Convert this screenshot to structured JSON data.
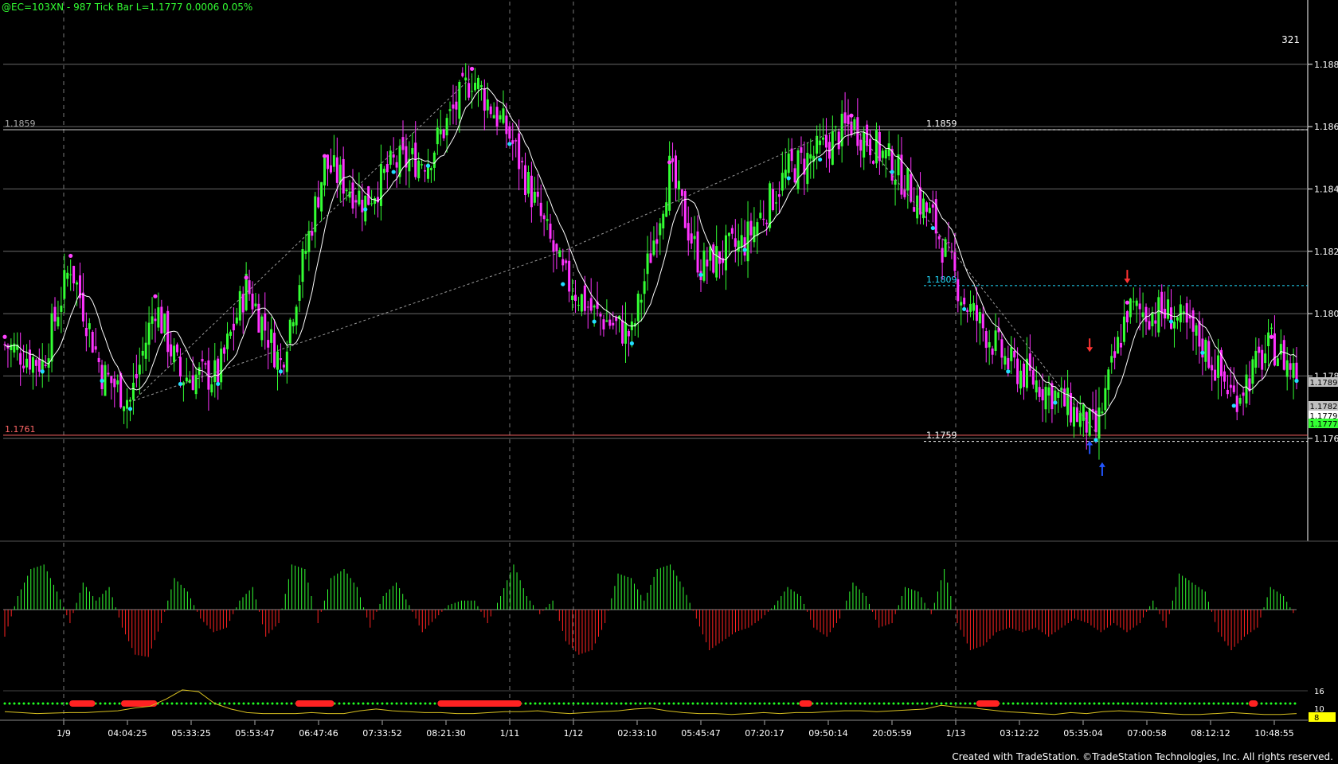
{
  "window": {
    "header": "@EC=103XN - 987 Tick Bar  L=1.1777  0.0006  0.05%",
    "bar_count": "321",
    "footer": "Created with TradeStation. ©TradeStation Technologies, Inc. All rights reserved."
  },
  "colors": {
    "background": "#000000",
    "bar_up": "#33ff33",
    "bar_down": "#ff33ff",
    "moving_average": "#ffffff",
    "hist_positive": "#33ff33",
    "hist_negative": "#ff2222",
    "swing_high_dot": "#ff44ff",
    "swing_low_dot": "#22ddff",
    "oscillator_line": "#d8c020",
    "state_dots": "#22ff22",
    "state_bars": "#ff2222"
  },
  "chart_data": {
    "type": "candlestick",
    "instrument": "@EC=103XN",
    "interval": "987 Tick Bar",
    "last": 1.1777,
    "change": 0.0006,
    "change_pct": "0.05%",
    "price_axis": {
      "ticks": [
        "1.1880",
        "1.1860",
        "1.1840",
        "1.1820",
        "1.1800",
        "1.1780",
        "1.1760"
      ],
      "ylim": [
        1.1727,
        1.1895
      ]
    },
    "time_axis": {
      "labels": [
        "1/9",
        "04:04:25",
        "05:33:25",
        "05:53:47",
        "06:47:46",
        "07:33:52",
        "08:21:30",
        "1/11",
        "1/12",
        "02:33:10",
        "05:45:47",
        "07:20:17",
        "09:50:14",
        "20:05:59",
        "1/13",
        "03:12:22",
        "05:35:04",
        "07:00:58",
        "08:12:12",
        "10:48:55"
      ],
      "date_separators": [
        "1/9",
        "1/11",
        "1/12",
        "1/13"
      ]
    },
    "price_tags": [
      {
        "text": "1.1789",
        "style": "gray"
      },
      {
        "text": "1.1782",
        "style": "gray"
      },
      {
        "text": "1.1779",
        "style": "white"
      },
      {
        "text": "1.1777",
        "style": "green"
      }
    ],
    "levels": [
      {
        "label": "1.1859",
        "value": 1.1859,
        "label_pos": "left"
      },
      {
        "label": "1.1761",
        "value": 1.1761,
        "label_pos": "left"
      },
      {
        "label": "1.1859",
        "value": 1.1859,
        "label_pos": "right"
      },
      {
        "label": "1.1809",
        "value": 1.1809,
        "label_pos": "right"
      },
      {
        "label": "1.1759",
        "value": 1.1759,
        "label_pos": "right"
      }
    ],
    "swing_points": [
      [
        0,
        1.179
      ],
      [
        12,
        1.1784
      ],
      [
        21,
        1.1816
      ],
      [
        31,
        1.1781
      ],
      [
        40,
        1.1772
      ],
      [
        48,
        1.1803
      ],
      [
        56,
        1.178
      ],
      [
        68,
        1.178
      ],
      [
        77,
        1.1809
      ],
      [
        88,
        1.1784
      ],
      [
        102,
        1.1848
      ],
      [
        115,
        1.1836
      ],
      [
        124,
        1.1848
      ],
      [
        135,
        1.185
      ],
      [
        149,
        1.1876
      ],
      [
        161,
        1.1857
      ],
      [
        178,
        1.1812
      ],
      [
        188,
        1.18
      ],
      [
        200,
        1.1793
      ],
      [
        212,
        1.1846
      ],
      [
        222,
        1.1815
      ],
      [
        236,
        1.1823
      ],
      [
        250,
        1.1846
      ],
      [
        260,
        1.1852
      ],
      [
        270,
        1.1861
      ],
      [
        283,
        1.1848
      ],
      [
        296,
        1.183
      ],
      [
        306,
        1.1804
      ],
      [
        320,
        1.1784
      ],
      [
        335,
        1.1774
      ],
      [
        348,
        1.1762
      ],
      [
        358,
        1.1801
      ],
      [
        372,
        1.18
      ],
      [
        382,
        1.179
      ],
      [
        392,
        1.1773
      ],
      [
        404,
        1.179
      ],
      [
        412,
        1.1781
      ]
    ],
    "moving_average": {
      "type": "line",
      "color": "white"
    },
    "oscillator": {
      "type": "histogram",
      "values": [
        -0.6,
        0.3,
        0.9,
        1.0,
        0.4,
        -0.3,
        0.6,
        0.2,
        0.5,
        -0.4,
        -1.0,
        -1.05,
        -0.3,
        0.7,
        0.4,
        -0.2,
        -0.5,
        -0.4,
        0.2,
        0.5,
        -0.6,
        -0.3,
        1.0,
        0.9,
        -0.3,
        0.7,
        0.9,
        0.5,
        -0.4,
        0.3,
        0.6,
        0.1,
        -0.5,
        -0.2,
        0.1,
        0.2,
        0.2,
        -0.3,
        0.3,
        1.0,
        0.3,
        -0.1,
        0.2,
        -0.7,
        -1.0,
        -0.9,
        -0.3,
        0.8,
        0.7,
        0.2,
        0.9,
        1.0,
        0.5,
        -0.2,
        -0.9,
        -0.7,
        -0.5,
        -0.4,
        -0.2,
        0.1,
        0.5,
        0.3,
        -0.4,
        -0.6,
        -0.2,
        0.6,
        0.3,
        -0.4,
        -0.3,
        0.5,
        0.4,
        -0.1,
        0.9,
        -0.3,
        -0.9,
        -0.8,
        -0.5,
        -0.4,
        -0.5,
        -0.4,
        -0.6,
        -0.4,
        -0.2,
        -0.3,
        -0.5,
        -0.3,
        -0.5,
        -0.3,
        0.2,
        -0.4,
        0.8,
        0.6,
        0.4,
        -0.5,
        -0.9,
        -0.6,
        -0.4,
        0.5,
        0.3,
        -0.2
      ],
      "ylim": [
        -1.2,
        1.2
      ]
    },
    "state_bar": {
      "type": "segments",
      "segments": [
        [
          0.05,
          0.07
        ],
        [
          0.09,
          0.118
        ],
        [
          0.225,
          0.255
        ],
        [
          0.335,
          0.4
        ],
        [
          0.615,
          0.625
        ],
        [
          0.752,
          0.77
        ],
        [
          0.963,
          0.97
        ]
      ]
    },
    "lower_axis": {
      "ticks": [
        "16",
        "10",
        "8"
      ]
    },
    "oscillator_line": {
      "values": [
        0.5,
        0.4,
        0.3,
        0.35,
        0.4,
        0.4,
        0.5,
        0.6,
        0.9,
        1.1,
        1.9,
        2.9,
        2.7,
        1.4,
        0.8,
        0.4,
        0.3,
        0.3,
        0.3,
        0.4,
        0.3,
        0.3,
        0.6,
        0.8,
        0.6,
        0.5,
        0.4,
        0.4,
        0.3,
        0.3,
        0.4,
        0.5,
        0.5,
        0.6,
        0.4,
        0.3,
        0.4,
        0.5,
        0.6,
        0.8,
        0.9,
        0.6,
        0.4,
        0.3,
        0.3,
        0.2,
        0.3,
        0.4,
        0.3,
        0.4,
        0.4,
        0.5,
        0.6,
        0.6,
        0.5,
        0.6,
        0.7,
        0.8,
        1.2,
        1.0,
        0.9,
        0.7,
        0.5,
        0.4,
        0.3,
        0.2,
        0.4,
        0.3,
        0.5,
        0.6,
        0.5,
        0.4,
        0.3,
        0.2,
        0.2,
        0.3,
        0.4,
        0.3,
        0.2,
        0.2,
        0.3
      ],
      "ylim": [
        0,
        3.5
      ]
    }
  }
}
